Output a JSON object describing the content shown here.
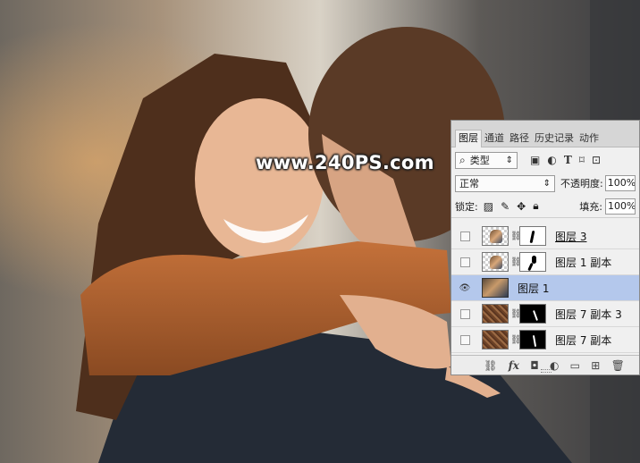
{
  "watermark": "www.240PS.com",
  "panel": {
    "tabs": [
      {
        "label": "图层",
        "active": true
      },
      {
        "label": "通道",
        "active": false
      },
      {
        "label": "路径",
        "active": false
      },
      {
        "label": "历史记录",
        "active": false
      },
      {
        "label": "动作",
        "active": false
      }
    ],
    "filter": {
      "search_glyph": "⌕",
      "type_label": "类型",
      "arrows": "⇕"
    },
    "blend": {
      "mode": "正常",
      "arrows": "⇕",
      "opacity_label": "不透明度:",
      "opacity_value": "100%"
    },
    "lock": {
      "label": "锁定:",
      "fill_label": "填充:",
      "fill_value": "100%"
    },
    "layers": [
      {
        "name": "图层 3",
        "visible": false,
        "selected": false,
        "thumb": "check",
        "mask": "white"
      },
      {
        "name": "图层 1 副本",
        "visible": false,
        "selected": false,
        "thumb": "check",
        "mask": "white"
      },
      {
        "name": "图层 1",
        "visible": true,
        "selected": true,
        "thumb": "photo",
        "mask": null
      },
      {
        "name": "图层 7 副本 3",
        "visible": false,
        "selected": false,
        "thumb": "tex",
        "mask": "black"
      },
      {
        "name": "图层 7 副本",
        "visible": false,
        "selected": false,
        "thumb": "tex",
        "mask": "black"
      }
    ],
    "bottom_fx": "fx"
  }
}
